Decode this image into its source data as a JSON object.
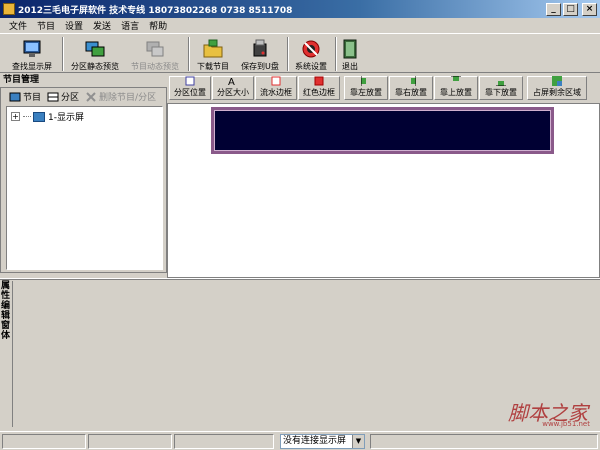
{
  "window": {
    "title": "2012三毛电子屏软件 技术专线 18073802268 0738 8511708",
    "min": "_",
    "max": "□",
    "close": "×"
  },
  "menu": [
    "文件",
    "节目",
    "设置",
    "发送",
    "语言",
    "帮助"
  ],
  "toolbar": {
    "find_screen": "查找显示屏",
    "static_preview": "分区静态预览",
    "dynamic_preview": "节目动态预览",
    "download": "下载节目",
    "save_usb": "保存到U盘",
    "system_settings": "系统设置",
    "exit": "退出"
  },
  "program_panel": {
    "title": "节目管理",
    "tools": {
      "program": "节目",
      "area": "分区",
      "delete": "删除节目/分区"
    },
    "tree": {
      "expander": "+",
      "node": "1-显示屏"
    }
  },
  "area_toolbar": {
    "position": "分区位置",
    "size": "分区大小",
    "flow_border": "流水边框",
    "red_border": "红色边框",
    "align_left": "靠左放置",
    "align_right": "靠右放置",
    "align_top": "靠上放置",
    "align_bottom": "靠下放置",
    "fill_rest": "占屏剩余区域"
  },
  "property_panel": {
    "title": "属\n性\n编\n辑\n窗\n体"
  },
  "statusbar": {
    "connection": "没有连接显示屏",
    "arrow": "▼"
  },
  "watermark": {
    "text": "脚本之家",
    "sub": "www.jb51.net"
  },
  "colors": {
    "titlebar": "#0a246a",
    "led_screen": "#000033",
    "led_border": "#8a5a8a",
    "panel": "#d4d0c8"
  }
}
